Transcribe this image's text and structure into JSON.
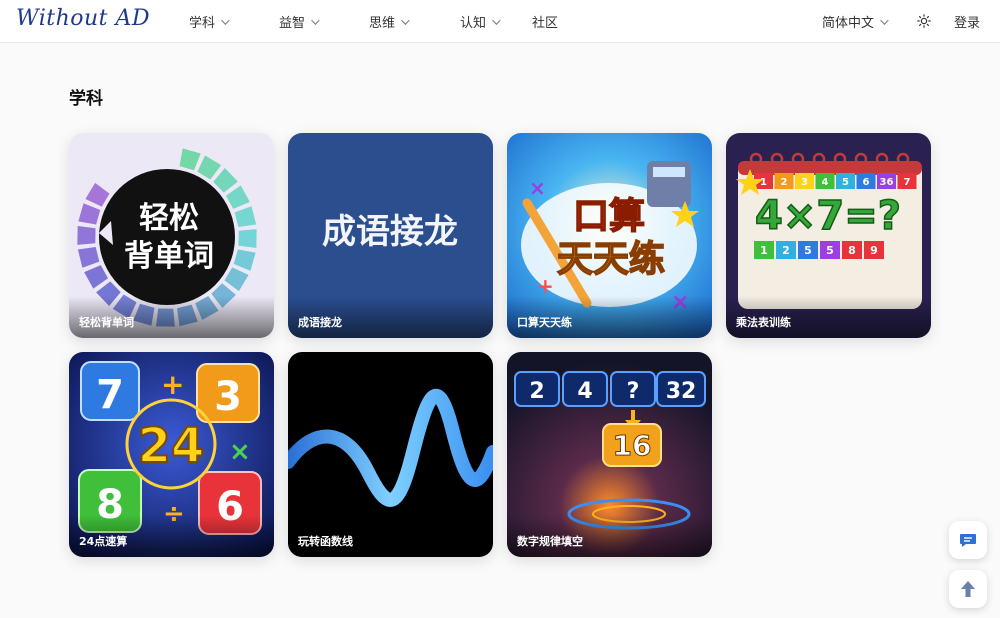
{
  "header": {
    "logo": "Without AD",
    "nav": [
      {
        "label": "学科",
        "has_dropdown": true
      },
      {
        "label": "益智",
        "has_dropdown": true
      },
      {
        "label": "思维",
        "has_dropdown": true
      },
      {
        "label": "认知",
        "has_dropdown": true
      },
      {
        "label": "社区",
        "has_dropdown": false
      }
    ],
    "language": "简体中文",
    "theme_icon": "sun-icon",
    "login": "登录"
  },
  "section": {
    "title": "学科",
    "cards": [
      {
        "label": "轻松背单词",
        "art_text": [
          "轻松",
          "背单词"
        ]
      },
      {
        "label": "成语接龙",
        "art_text": [
          "成语接龙"
        ]
      },
      {
        "label": "口算天天练",
        "art_text": [
          "口算",
          "天天练"
        ]
      },
      {
        "label": "乘法表训练",
        "art_text": [
          "4×7=?"
        ],
        "art_numbers_top": [
          "1",
          "2",
          "3",
          "4",
          "5",
          "6",
          "36",
          "7"
        ],
        "art_numbers_bottom": [
          "1",
          "2",
          "5",
          "5",
          "8",
          "9"
        ]
      },
      {
        "label": "24点速算",
        "art_text": [
          "24"
        ],
        "art_numbers": [
          "7",
          "3",
          "8",
          "6"
        ]
      },
      {
        "label": "玩转函数线",
        "art_text": []
      },
      {
        "label": "数字规律填空",
        "art_text": [
          "2",
          "4",
          "?",
          "32",
          "16"
        ]
      }
    ]
  },
  "floating": {
    "chat_icon": "chat-icon",
    "top_icon": "arrow-up-icon"
  },
  "colors": {
    "logo": "#1f3a8a",
    "card1_bg": "#e9e4f5",
    "card2_bg": "#2b4e8f",
    "card3_bg": "#3aa0e8",
    "card4_bg": "#2a2150",
    "card5_bg": "#1a2a7a",
    "card6_bg": "#000000",
    "card7_bg": "#2a1a3a"
  }
}
